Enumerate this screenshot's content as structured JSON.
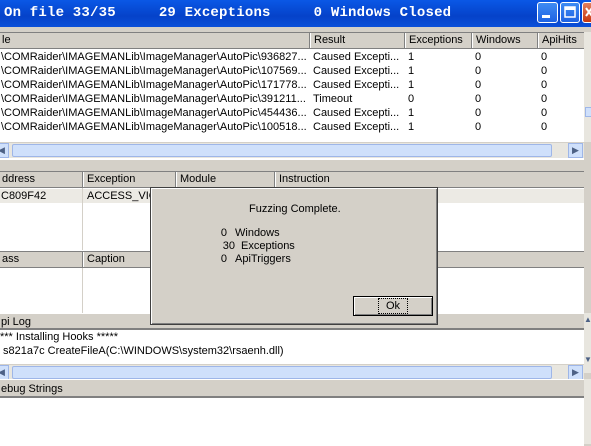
{
  "title": "On file 33/35     29 Exceptions     0 Windows Closed",
  "window_buttons": {
    "minimize": "minimize",
    "maximize": "maximize",
    "close": "close"
  },
  "results_table": {
    "columns": [
      "le",
      "Result",
      "Exceptions",
      "Windows",
      "ApiHits"
    ],
    "rows": [
      {
        "file": "\\COMRaider\\IMAGEMANLib\\ImageManager\\AutoPic\\936827...",
        "result": "Caused Excepti...",
        "exceptions": "1",
        "windows": "0",
        "apihits": "0"
      },
      {
        "file": "\\COMRaider\\IMAGEMANLib\\ImageManager\\AutoPic\\107569...",
        "result": "Caused Excepti...",
        "exceptions": "1",
        "windows": "0",
        "apihits": "0"
      },
      {
        "file": "\\COMRaider\\IMAGEMANLib\\ImageManager\\AutoPic\\171778...",
        "result": "Caused Excepti...",
        "exceptions": "1",
        "windows": "0",
        "apihits": "0"
      },
      {
        "file": "\\COMRaider\\IMAGEMANLib\\ImageManager\\AutoPic\\391211...",
        "result": "Timeout",
        "exceptions": "0",
        "windows": "0",
        "apihits": "0"
      },
      {
        "file": "\\COMRaider\\IMAGEMANLib\\ImageManager\\AutoPic\\454436...",
        "result": "Caused Excepti...",
        "exceptions": "1",
        "windows": "0",
        "apihits": "0"
      },
      {
        "file": "\\COMRaider\\IMAGEMANLib\\ImageManager\\AutoPic\\100518...",
        "result": "Caused Excepti...",
        "exceptions": "1",
        "windows": "0",
        "apihits": "0"
      }
    ]
  },
  "exceptions_table": {
    "columns": [
      "ddress",
      "Exception",
      "Module",
      "Instruction"
    ],
    "rows": [
      {
        "address": "C809F42",
        "exception": "ACCESS_VIO"
      }
    ]
  },
  "windows_table": {
    "columns": [
      "ass",
      "Caption"
    ]
  },
  "api_log": {
    "header": "pi Log",
    "lines": [
      "*** Installing Hooks *****",
      "s821a7c     CreateFileA(C:\\WINDOWS\\system32\\rsaenh.dll)"
    ]
  },
  "debug_strings": {
    "header": "ebug Strings"
  },
  "dialog": {
    "title": "Fuzzing Complete.",
    "stats": [
      {
        "count": "0",
        "label": "Windows"
      },
      {
        "count": "30",
        "label": "Exceptions"
      },
      {
        "count": "0",
        "label": "ApiTriggers"
      }
    ],
    "ok_label": "Ok"
  },
  "colors": {
    "titlebar": "#0542c9",
    "window_bg": "#d4d0c8",
    "scroll_thumb": "#cfe0fb"
  }
}
